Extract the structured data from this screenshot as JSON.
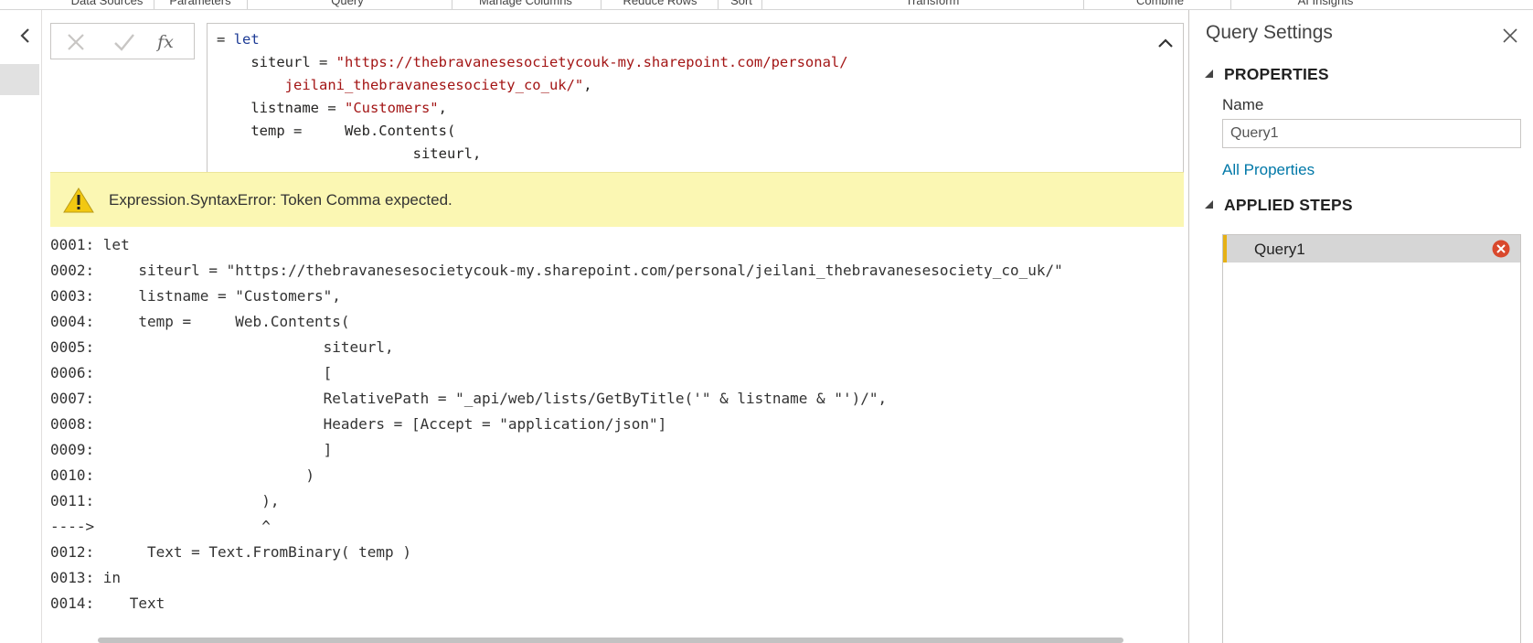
{
  "ribbon": {
    "groups": [
      "Data Sources",
      "Parameters",
      "Query",
      "Manage Columns",
      "Reduce Rows",
      "Sort",
      "Transform",
      "Combine",
      "AI Insights"
    ]
  },
  "formula_bar": {
    "cancel_icon": "x-icon",
    "commit_icon": "checkmark-icon",
    "fx_label": "fx",
    "lines": [
      {
        "indent": "",
        "parts": [
          {
            "t": "= ",
            "c": "plain"
          },
          {
            "t": "let",
            "c": "kw"
          }
        ]
      },
      {
        "indent": "    ",
        "parts": [
          {
            "t": "siteurl = ",
            "c": "plain"
          },
          {
            "t": "\"https://thebravanesesocietycouk-my.sharepoint.com/personal/",
            "c": "str"
          }
        ]
      },
      {
        "indent": "        ",
        "parts": [
          {
            "t": "jeilani_thebravanesesociety_co_uk/\"",
            "c": "str"
          },
          {
            "t": ",",
            "c": "plain"
          }
        ]
      },
      {
        "indent": "    ",
        "parts": [
          {
            "t": "listname = ",
            "c": "plain"
          },
          {
            "t": "\"Customers\"",
            "c": "str"
          },
          {
            "t": ",",
            "c": "plain"
          }
        ]
      },
      {
        "indent": "    ",
        "parts": [
          {
            "t": "temp =     Web.Contents(",
            "c": "plain"
          }
        ]
      },
      {
        "indent": "                       ",
        "parts": [
          {
            "t": "siteurl,",
            "c": "plain"
          }
        ]
      }
    ]
  },
  "error": {
    "icon": "warning-icon",
    "message": "Expression.SyntaxError: Token Comma expected."
  },
  "listing": [
    "0001: let",
    "0002:     siteurl = \"https://thebravanesesocietycouk-my.sharepoint.com/personal/jeilani_thebravanesesociety_co_uk/\"",
    "0003:     listname = \"Customers\",",
    "0004:     temp =     Web.Contents(",
    "0005:                          siteurl,",
    "0006:                          [",
    "0007:                          RelativePath = \"_api/web/lists/GetByTitle('\" & listname & \"')/\",",
    "0008:                          Headers = [Accept = \"application/json\"]",
    "0009:                          ]",
    "0010:                        )",
    "0011:                   ),",
    "---->                   ^",
    "0012:      Text = Text.FromBinary( temp )",
    "0013: in",
    "0014:    Text"
  ],
  "query_settings": {
    "title": "Query Settings",
    "properties_heading": "PROPERTIES",
    "name_label": "Name",
    "name_value": "Query1",
    "all_properties_link": "All Properties",
    "applied_steps_heading": "APPLIED STEPS",
    "steps": [
      {
        "label": "Query1",
        "status": "error"
      }
    ]
  },
  "colors": {
    "keyword": "#1e3c96",
    "string": "#a31515",
    "error_banner": "#fbf7b3",
    "link": "#0078a8",
    "step_accent": "#e6b116",
    "step_error": "#d9492d"
  }
}
